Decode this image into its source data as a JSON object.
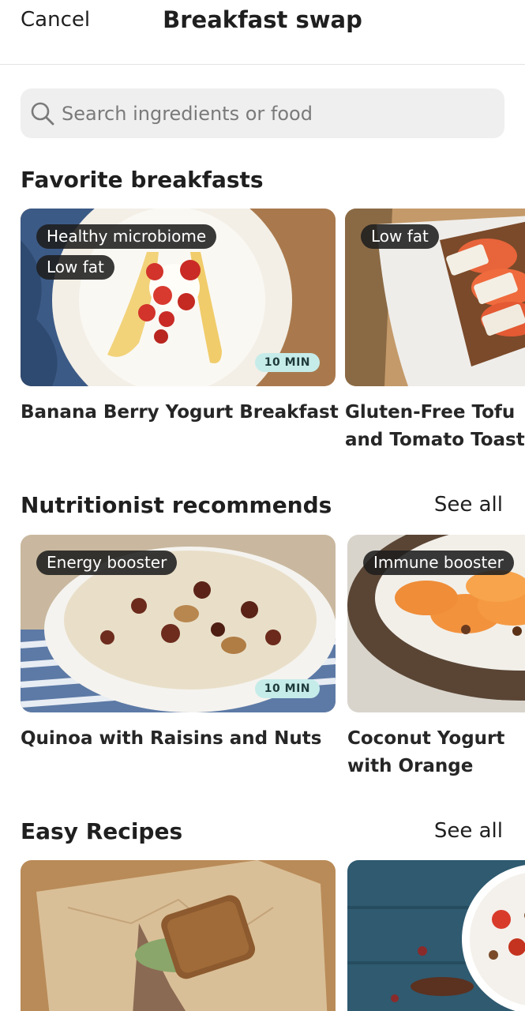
{
  "header": {
    "cancel_label": "Cancel",
    "title": "Breakfast swap"
  },
  "search": {
    "placeholder": "Search ingredients or food",
    "value": ""
  },
  "sections": [
    {
      "title": "Favorite breakfasts",
      "see_all": "",
      "cards": [
        {
          "name": "Banana Berry Yogurt Breakfast",
          "tags": [
            "Healthy microbiome",
            "Low fat"
          ],
          "time": "10 MIN"
        },
        {
          "name": "Gluten-Free Tofu and Tomato Toast",
          "tags": [
            "Low fat"
          ],
          "time": ""
        }
      ]
    },
    {
      "title": "Nutritionist recommends",
      "see_all": "See all",
      "cards": [
        {
          "name": "Quinoa with Raisins and Nuts",
          "tags": [
            "Energy booster"
          ],
          "time": "10 MIN"
        },
        {
          "name": "Coconut Yogurt with Orange",
          "tags": [
            "Immune booster"
          ],
          "time": ""
        }
      ]
    },
    {
      "title": "Easy Recipes",
      "see_all": "See all",
      "cards": [
        {
          "name": "",
          "tags": [],
          "time": ""
        },
        {
          "name": "",
          "tags": [],
          "time": ""
        }
      ]
    }
  ]
}
